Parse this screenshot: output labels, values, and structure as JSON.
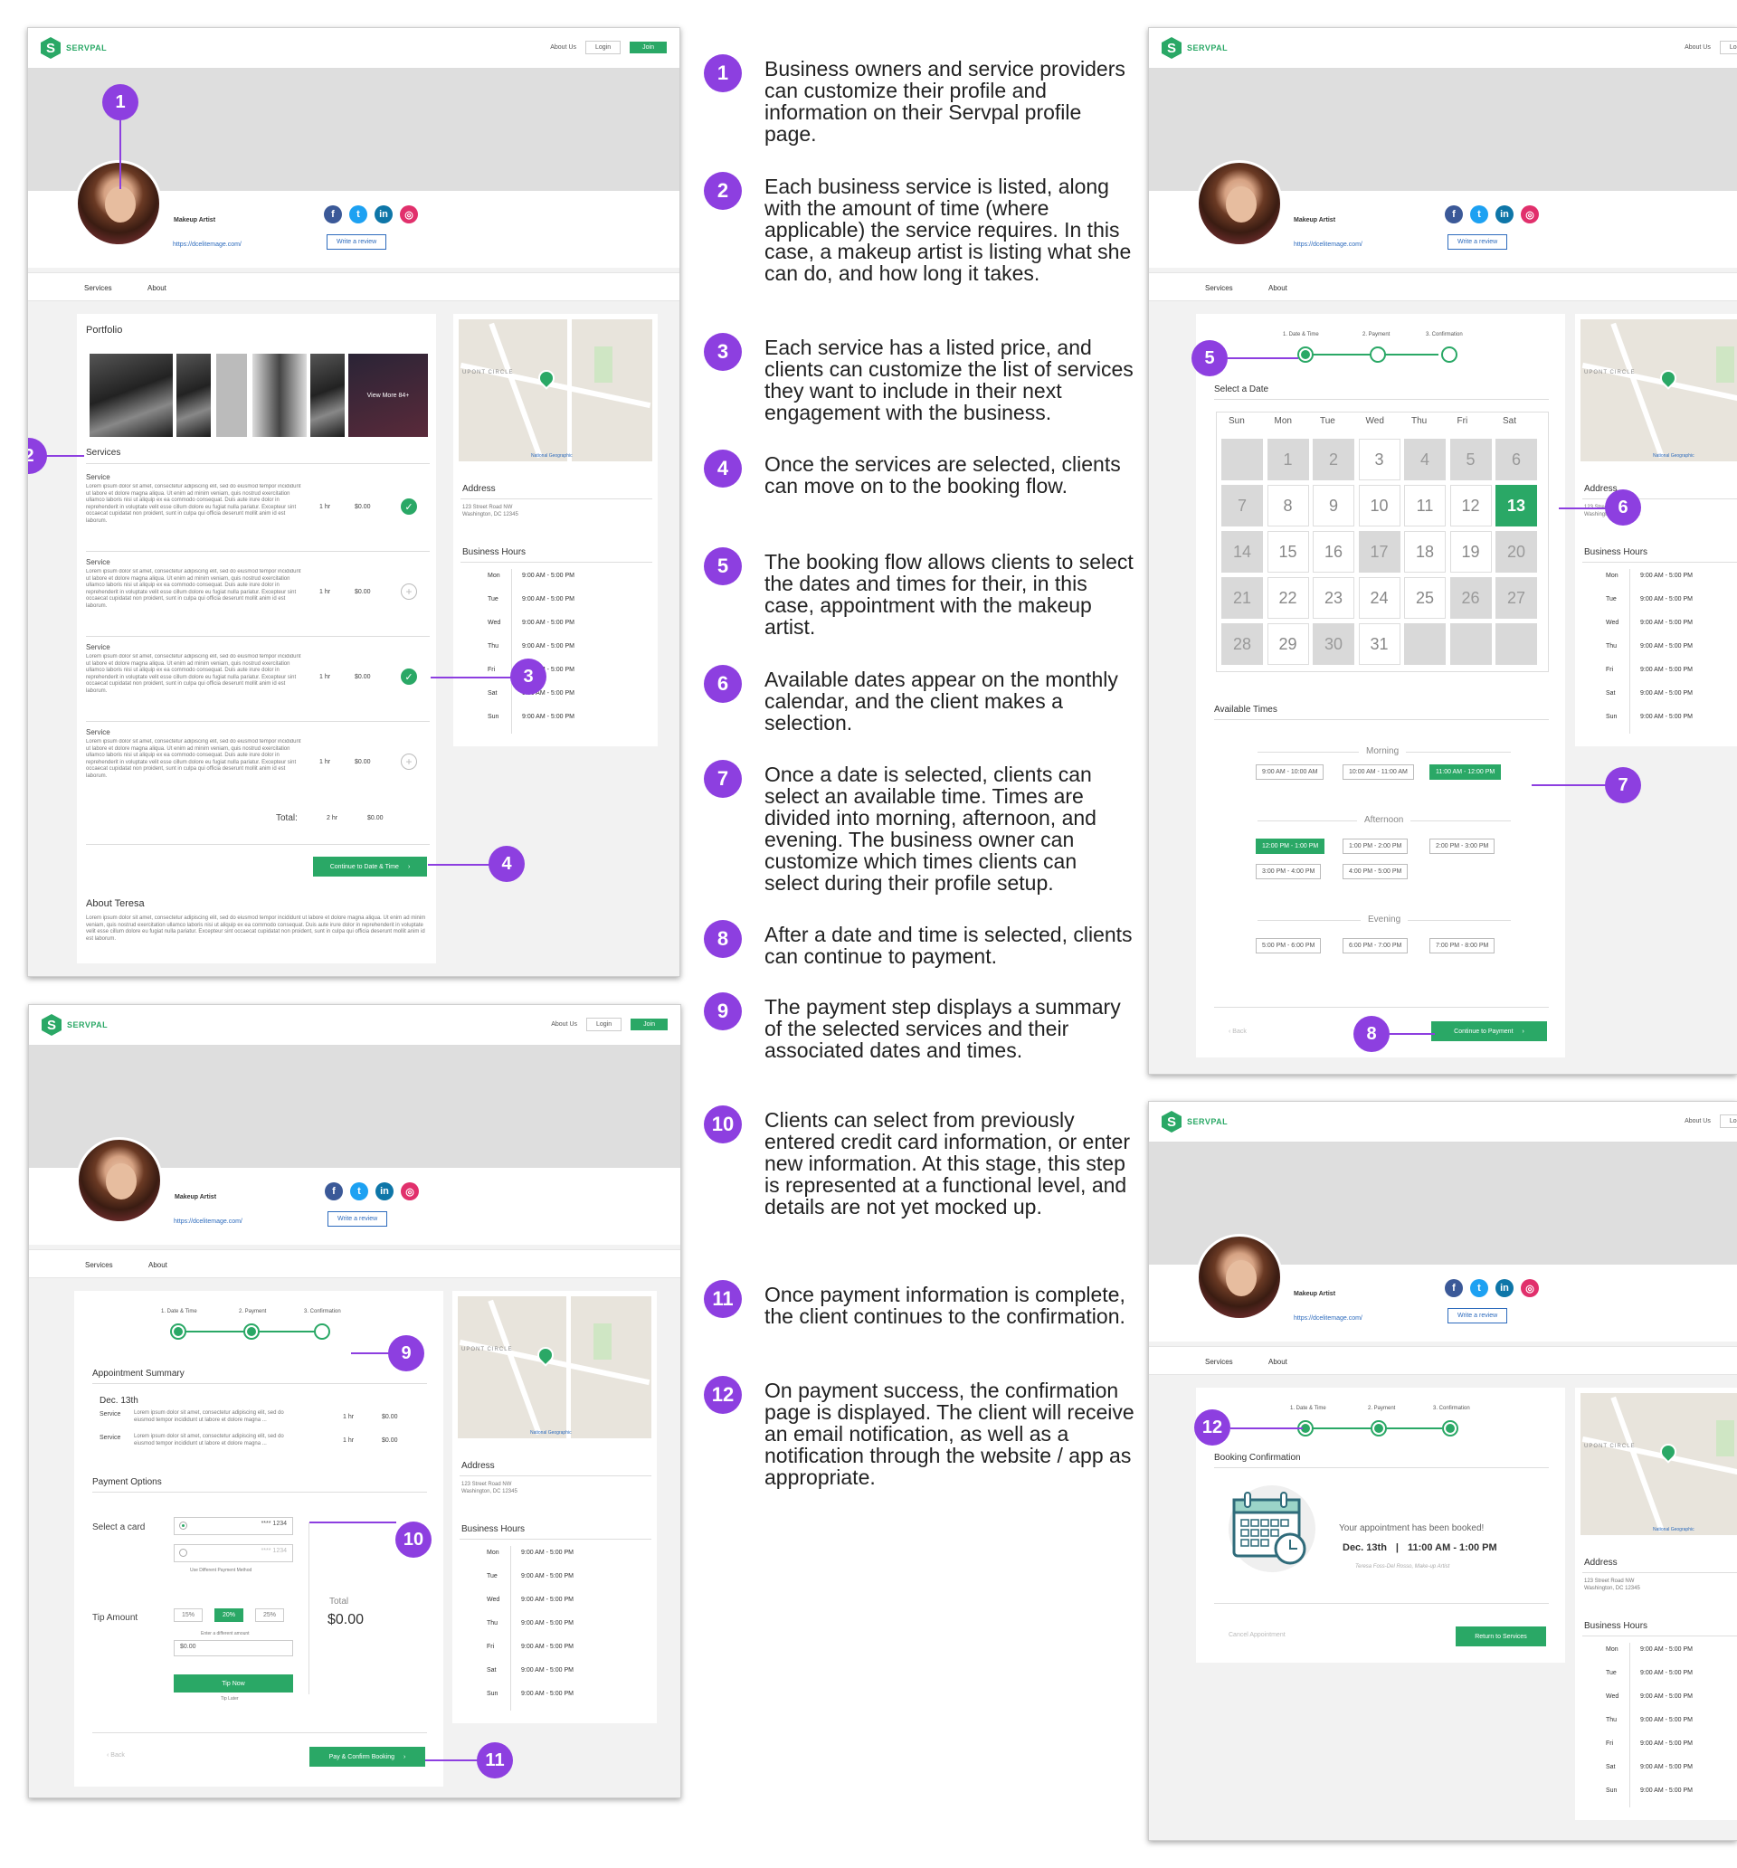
{
  "brand": {
    "name": "SERVPAL",
    "mark": "S"
  },
  "nav": {
    "about": "About Us",
    "login": "Login",
    "join": "Join"
  },
  "profile": {
    "role": "Makeup Artist",
    "website": "https://dcelitemage.com/",
    "review_button": "Write a review",
    "tabs": [
      "Services",
      "About"
    ]
  },
  "services_page": {
    "portfolio_title": "Portfolio",
    "view_more": "View More 84+",
    "services_title": "Services",
    "service_name": "Service",
    "lorem": "Lorem ipsum dolor sit amet, consectetur adipiscing elit, sed do eiusmod tempor incididunt ut labore et dolore magna aliqua. Ut enim ad minim veniam, quis nostrud exercitation ullamco laboris nisi ut aliquip ex ea commodo consequat. Duis aute irure dolor in reprehenderit in voluptate velit esse cillum dolore eu fugiat nulla pariatur. Excepteur sint occaecat cupidatat non proident, sunt in culpa qui officia deserunt mollit anim id est laborum.",
    "duration": "1 hr",
    "price": "$0.00",
    "total_label": "Total:",
    "total_duration": "2 hr",
    "total_price": "$0.00",
    "continue": "Continue to Date & Time",
    "about_title": "About Teresa",
    "about_text": "Lorem ipsum dolor sit amet, consectetur adipiscing elit, sed do eiusmod tempor incididunt ut labore et dolore magna aliqua. Ut enim ad minim veniam, quis nostrud exercitation ullamco laboris nisi ut aliquip ex ea commodo consequat. Duis aute irure dolor in reprehenderit in voluptate velit esse cillum dolore eu fugiat nulla pariatur. Excepteur sint occaecat cupidatat non proident, sunt in culpa qui officia deserunt mollit anim id est laborum."
  },
  "sidebar": {
    "map_circle": "UPONT CIRCLE",
    "map_credit": "National Geographic",
    "address_title": "Address",
    "address_line1": "123 Street Road NW",
    "address_line2": "Washington, DC 12345",
    "hours_title": "Business Hours",
    "days": [
      "Mon",
      "Tue",
      "Wed",
      "Thu",
      "Fri",
      "Sat",
      "Sun"
    ],
    "hours": "9:00 AM - 5:00 PM"
  },
  "stepper": {
    "steps": [
      "1. Date & Time",
      "2. Payment",
      "3. Confirmation"
    ]
  },
  "booking": {
    "select_date": "Select a Date",
    "weekdays": [
      "Sun",
      "Mon",
      "Tue",
      "Wed",
      "Thu",
      "Fri",
      "Sat"
    ],
    "available_times": "Available Times",
    "morning": "Morning",
    "afternoon": "Afternoon",
    "evening": "Evening",
    "morning_slots": [
      "9:00 AM - 10:00 AM",
      "10:00 AM - 11:00 AM",
      "11:00 AM - 12:00 PM"
    ],
    "afternoon_slots": [
      "12:00 PM - 1:00 PM",
      "1:00 PM - 2:00 PM",
      "2:00 PM - 3:00 PM",
      "3:00 PM - 4:00 PM",
      "4:00 PM - 5:00 PM"
    ],
    "evening_slots": [
      "5:00 PM - 6:00 PM",
      "6:00 PM - 7:00 PM",
      "7:00 PM - 8:00 PM"
    ],
    "back": "Back",
    "continue": "Continue to Payment"
  },
  "payment": {
    "summary_title": "Appointment Summary",
    "date": "Dec. 13th",
    "service_label": "Service",
    "service_text": "Lorem ipsum dolor sit amet, consectetur adipiscing elit, sed do eiusmod tempor incididunt ut labore et dolore magna ...",
    "duration": "1 hr",
    "price": "$0.00",
    "options_title": "Payment Options",
    "select_card": "Select a card",
    "card_1": "**** 1234",
    "card_2": "**** 1234",
    "different_method": "Use Different Payment Method",
    "tip_label": "Tip Amount",
    "tips": [
      "15%",
      "20%",
      "25%"
    ],
    "tip_other": "Enter a different amount",
    "tip_input": "$0.00",
    "tip_now": "Tip Now",
    "tip_later": "Tip Later",
    "total_label": "Total",
    "total_value": "$0.00",
    "back": "Back",
    "pay": "Pay & Confirm Booking"
  },
  "confirmation": {
    "title": "Booking Confirmation",
    "message": "Your appointment has been booked!",
    "date": "Dec. 13th",
    "separator": "|",
    "time": "11:00 AM - 1:00 PM",
    "artist": "Teresa Foss-Del Rosso, Make-up Artist",
    "cancel": "Cancel Appointment",
    "return": "Return to Services"
  },
  "annotations": [
    {
      "num": "1",
      "text": "Business owners and service providers can customize their profile and information on their Servpal profile page."
    },
    {
      "num": "2",
      "text": "Each business service is listed, along with the amount of time (where applicable) the service requires. In this case, a makeup artist is listing what she can do, and how long it takes."
    },
    {
      "num": "3",
      "text": "Each service has a listed price, and clients can customize the list of services they want to include in their next engagement with the business."
    },
    {
      "num": "4",
      "text": "Once the services are selected, clients can move on to the booking flow."
    },
    {
      "num": "5",
      "text": "The booking flow allows clients to select the dates and times for their, in this case, appointment with the makeup artist."
    },
    {
      "num": "6",
      "text": "Available dates appear on the monthly calendar, and the client makes a selection."
    },
    {
      "num": "7",
      "text": "Once a date is selected, clients can select an available time. Times are divided into morning, afternoon, and evening. The business owner can customize which times clients can select during their profile setup."
    },
    {
      "num": "8",
      "text": "After a date and time is selected, clients can continue to payment."
    },
    {
      "num": "9",
      "text": "The payment step displays a summary of the selected services and their associated dates and times."
    },
    {
      "num": "10",
      "text": "Clients can select from previously entered credit card information, or enter new information. At this stage, this step is represented at a functional level, and details are not yet mocked up."
    },
    {
      "num": "11",
      "text": "Once payment information is complete, the client continues to the confirmation."
    },
    {
      "num": "12",
      "text": "On payment success, the confirmation page is displayed. The client will receive an email notification, as well as a notification through the website / app as appropriate."
    }
  ],
  "calendar_days": [
    {
      "label": "",
      "state": "disabled"
    },
    {
      "label": "1",
      "state": "disabled"
    },
    {
      "label": "2",
      "state": "disabled"
    },
    {
      "label": "3",
      "state": "available"
    },
    {
      "label": "4",
      "state": "disabled"
    },
    {
      "label": "5",
      "state": "disabled"
    },
    {
      "label": "6",
      "state": "disabled"
    },
    {
      "label": "7",
      "state": "disabled"
    },
    {
      "label": "8",
      "state": "available"
    },
    {
      "label": "9",
      "state": "available"
    },
    {
      "label": "10",
      "state": "available"
    },
    {
      "label": "11",
      "state": "available"
    },
    {
      "label": "12",
      "state": "available"
    },
    {
      "label": "13",
      "state": "selected"
    },
    {
      "label": "14",
      "state": "disabled"
    },
    {
      "label": "15",
      "state": "available"
    },
    {
      "label": "16",
      "state": "available"
    },
    {
      "label": "17",
      "state": "disabled"
    },
    {
      "label": "18",
      "state": "available"
    },
    {
      "label": "19",
      "state": "available"
    },
    {
      "label": "20",
      "state": "disabled"
    },
    {
      "label": "21",
      "state": "disabled"
    },
    {
      "label": "22",
      "state": "available"
    },
    {
      "label": "23",
      "state": "available"
    },
    {
      "label": "24",
      "state": "available"
    },
    {
      "label": "25",
      "state": "available"
    },
    {
      "label": "26",
      "state": "disabled"
    },
    {
      "label": "27",
      "state": "disabled"
    },
    {
      "label": "28",
      "state": "disabled"
    },
    {
      "label": "29",
      "state": "available"
    },
    {
      "label": "30",
      "state": "disabled"
    },
    {
      "label": "31",
      "state": "available"
    },
    {
      "label": "",
      "state": "disabled"
    },
    {
      "label": "",
      "state": "disabled"
    },
    {
      "label": "",
      "state": "disabled"
    }
  ],
  "services_selected": [
    true,
    false,
    true,
    false
  ],
  "colors": {
    "brand_green": "#2aa866",
    "annotation_purple": "#8d3fe0",
    "link_blue": "#2d6bbd"
  }
}
